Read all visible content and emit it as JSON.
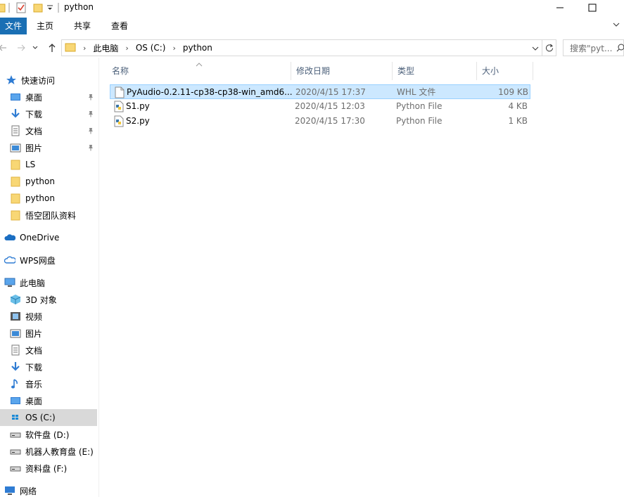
{
  "window": {
    "title": "python",
    "minimize_glyph": "—",
    "maximize_glyph": "☐",
    "close_glyph": "✕"
  },
  "ribbon": {
    "tabs": [
      "文件",
      "主页",
      "共享",
      "查看"
    ]
  },
  "address": {
    "crumbs": [
      "此电脑",
      "OS (C:)",
      "python"
    ],
    "search_placeholder": "搜索\"pyt..."
  },
  "sidebar": {
    "quick_access": "快速访问",
    "quick_items": [
      {
        "label": "桌面",
        "icon": "desktop-icon",
        "pinned": true
      },
      {
        "label": "下载",
        "icon": "download-icon",
        "pinned": true
      },
      {
        "label": "文档",
        "icon": "document-icon",
        "pinned": true
      },
      {
        "label": "图片",
        "icon": "picture-icon",
        "pinned": true
      },
      {
        "label": "LS",
        "icon": "folder-icon",
        "pinned": false
      },
      {
        "label": "python",
        "icon": "folder-icon",
        "pinned": false
      },
      {
        "label": "python",
        "icon": "folder-icon",
        "pinned": false
      },
      {
        "label": "悟空团队资料",
        "icon": "folder-icon",
        "pinned": false
      }
    ],
    "onedrive": "OneDrive",
    "wps": "WPS网盘",
    "this_pc": "此电脑",
    "pc_items": [
      {
        "label": "3D 对象",
        "icon": "3d-objects-icon"
      },
      {
        "label": "视频",
        "icon": "video-icon"
      },
      {
        "label": "图片",
        "icon": "picture-icon"
      },
      {
        "label": "文档",
        "icon": "document-icon"
      },
      {
        "label": "下载",
        "icon": "download-icon"
      },
      {
        "label": "音乐",
        "icon": "music-icon"
      },
      {
        "label": "桌面",
        "icon": "desktop-icon"
      },
      {
        "label": "OS (C:)",
        "icon": "windows-drive-icon",
        "selected": true
      },
      {
        "label": "软件盘 (D:)",
        "icon": "drive-icon"
      },
      {
        "label": "机器人教育盘 (E:)",
        "icon": "drive-icon"
      },
      {
        "label": "资料盘 (F:)",
        "icon": "drive-icon"
      }
    ],
    "network": "网络"
  },
  "files": {
    "columns": [
      "名称",
      "修改日期",
      "类型",
      "大小"
    ],
    "rows": [
      {
        "name": "PyAudio-0.2.11-cp38-cp38-win_amd6...",
        "date": "2020/4/15 17:37",
        "type": "WHL 文件",
        "size": "109 KB",
        "icon": "generic-file-icon",
        "selected": true
      },
      {
        "name": "S1.py",
        "date": "2020/4/15 12:03",
        "type": "Python File",
        "size": "4 KB",
        "icon": "python-file-icon",
        "selected": false
      },
      {
        "name": "S2.py",
        "date": "2020/4/15 17:30",
        "type": "Python File",
        "size": "1 KB",
        "icon": "python-file-icon",
        "selected": false
      }
    ]
  },
  "colors": {
    "accent": "#1a6fb4",
    "selection": "#cce8ff",
    "folder": "#f8d775"
  }
}
